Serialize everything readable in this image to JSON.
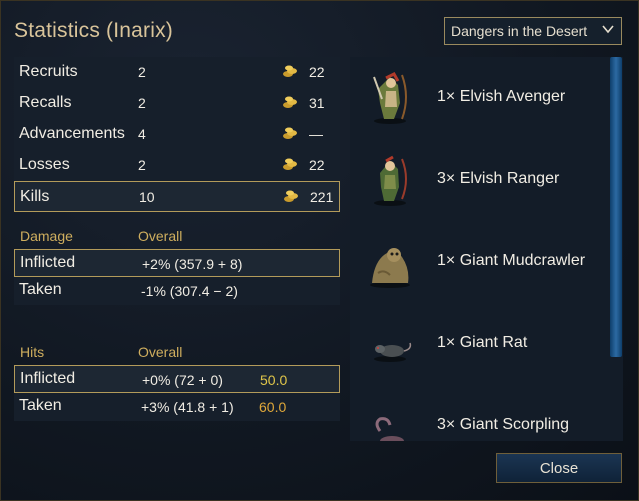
{
  "dialog": {
    "title": "Statistics (Inarix)",
    "scenario_select": "Dangers in the Desert",
    "close_label": "Close"
  },
  "summary": [
    {
      "label": "Recruits",
      "count": "2",
      "cost": "22"
    },
    {
      "label": "Recalls",
      "count": "2",
      "cost": "31"
    },
    {
      "label": "Advancements",
      "count": "4",
      "cost": "—"
    },
    {
      "label": "Losses",
      "count": "2",
      "cost": "22"
    },
    {
      "label": "Kills",
      "count": "10",
      "cost": "221"
    }
  ],
  "damage": {
    "header": "Damage",
    "col": "Overall",
    "rows": [
      {
        "label": "Inflicted",
        "value": "+2% (357.9 + 8)",
        "pct": ""
      },
      {
        "label": "Taken",
        "value": "-1% (307.4 − 2)",
        "pct": ""
      }
    ]
  },
  "hits": {
    "header": "Hits",
    "col": "Overall",
    "rows": [
      {
        "label": "Inflicted",
        "value": "+0% (72 + 0)",
        "pct": "50.0"
      },
      {
        "label": "Taken",
        "value": "+3% (41.8 + 1)",
        "pct": "60.0"
      }
    ]
  },
  "units": [
    {
      "name": "1× Elvish Avenger"
    },
    {
      "name": "3× Elvish Ranger"
    },
    {
      "name": "1× Giant Mudcrawler"
    },
    {
      "name": "1× Giant Rat"
    },
    {
      "name": "3× Giant Scorpling"
    }
  ],
  "colors": {
    "gold": "#cfae5e",
    "accent": "#2c6aa3",
    "highlight_border": "#b39b5a"
  }
}
